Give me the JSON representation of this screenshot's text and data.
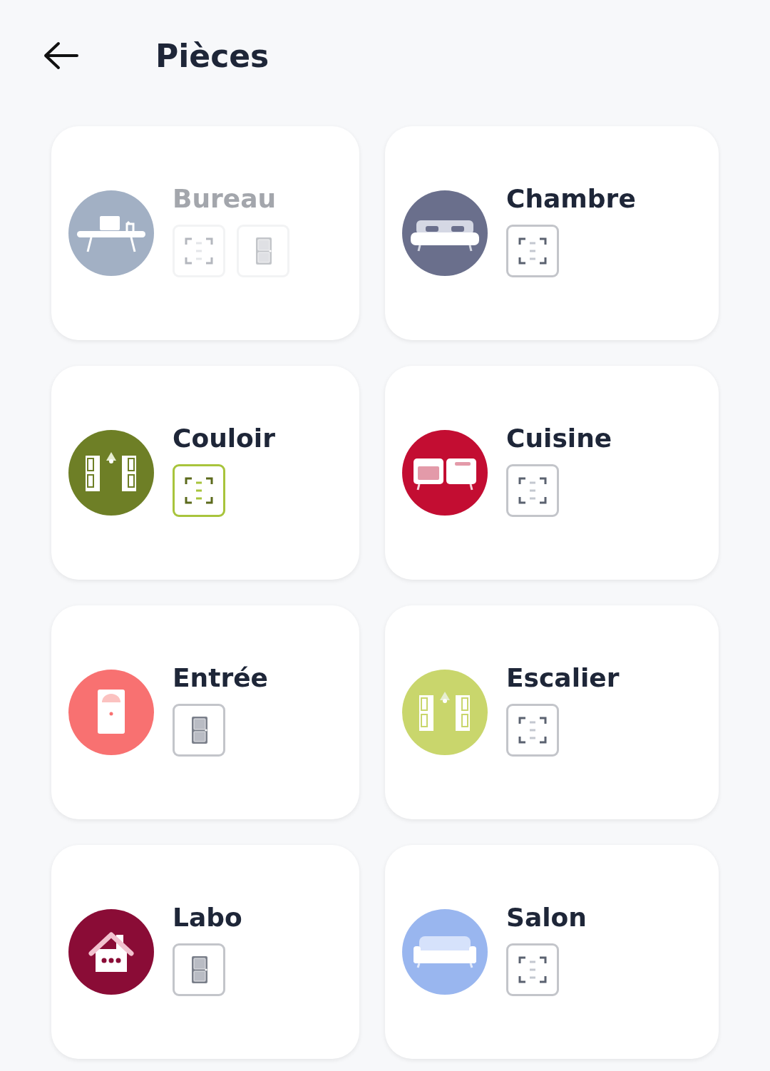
{
  "header": {
    "title": "Pièces"
  },
  "rooms": [
    {
      "name": "Bureau",
      "kind": "desk",
      "color": "#a2b0c4",
      "disabled": true,
      "devices": [
        {
          "kind": "sensor",
          "active": false
        },
        {
          "kind": "door",
          "active": false
        }
      ]
    },
    {
      "name": "Chambre",
      "kind": "bed",
      "color": "#6a6f8c",
      "disabled": false,
      "devices": [
        {
          "kind": "sensor",
          "active": false
        }
      ]
    },
    {
      "name": "Couloir",
      "kind": "corridor",
      "color": "#6e7f26",
      "disabled": false,
      "devices": [
        {
          "kind": "sensor",
          "active": true
        }
      ]
    },
    {
      "name": "Cuisine",
      "kind": "kitchen",
      "color": "#c30d32",
      "disabled": false,
      "devices": [
        {
          "kind": "sensor",
          "active": false
        }
      ]
    },
    {
      "name": "Entrée",
      "kind": "door",
      "color": "#f87171",
      "disabled": false,
      "devices": [
        {
          "kind": "door",
          "active": false
        }
      ]
    },
    {
      "name": "Escalier",
      "kind": "corridor",
      "color": "#c9d66c",
      "disabled": false,
      "devices": [
        {
          "kind": "sensor",
          "active": false
        }
      ]
    },
    {
      "name": "Labo",
      "kind": "house",
      "color": "#8a0c36",
      "disabled": false,
      "devices": [
        {
          "kind": "door",
          "active": false
        }
      ]
    },
    {
      "name": "Salon",
      "kind": "sofa",
      "color": "#99b6ef",
      "disabled": false,
      "devices": [
        {
          "kind": "sensor",
          "active": false
        }
      ]
    }
  ]
}
